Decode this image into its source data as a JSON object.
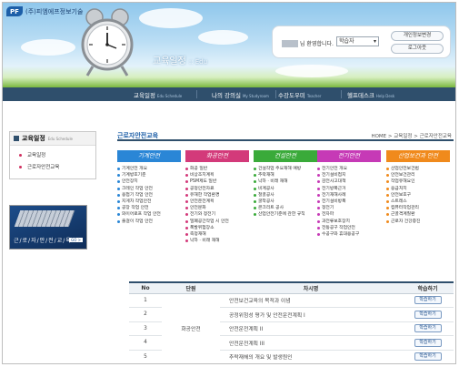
{
  "logo": {
    "badge": "PF",
    "company": "(주)피엠에프정보기술"
  },
  "header": {
    "title": "교육일정",
    "title_sub": ":: Edu"
  },
  "login": {
    "greeting": "님 환영합니다.",
    "role_selected": "학습자",
    "personal_info_btn": "개인정보변경",
    "logout_btn": "로그아웃"
  },
  "nav": {
    "items": [
      {
        "label": "교육일정",
        "sub": "Edu Schedule"
      },
      {
        "label": "나의 강의실",
        "sub": "My Studyroom"
      },
      {
        "label": "수강도우미",
        "sub": "Teacher"
      },
      {
        "label": "헬프데스크",
        "sub": "Help Desk"
      }
    ]
  },
  "sidebar": {
    "title": "교육일정",
    "title_sub": "Edu Schedule",
    "items": [
      {
        "label": "교육일정"
      },
      {
        "label": "근로자안전교육"
      }
    ],
    "banner_text": "근/로/자/안/전/교/육",
    "banner_go": "GO >"
  },
  "main": {
    "page_title": "근로자안전교육",
    "breadcrumb": "HOME > 교육일정 > 근로자안전교육",
    "categories": [
      {
        "title": "기계안전",
        "color": "#2a86d6",
        "items": [
          "기계안전 개요",
          "기계방호기준",
          "안전장치",
          "크레인 작업 안전",
          "용접기 작업 안전",
          "지게차 작업안전",
          "공장 작업 안전",
          "와이어로프 작업 안전",
          "줄걸이 작업 안전"
        ]
      },
      {
        "title": "화공안전",
        "color": "#d33a7a",
        "items": [
          "화공 일반",
          "비상조치계획",
          "PSM제도 일반",
          "공정안전자료",
          "유해한 작업환경",
          "안전운전계획",
          "안전문화",
          "전기와 정전기",
          "밀폐공간작업 시 안전",
          "폭발위험장소",
          "측정재해",
          "낙하 · 비래 재해"
        ]
      },
      {
        "title": "건설안전",
        "color": "#3aaa3a",
        "items": [
          "건설작업 주요재해 예방",
          "추락재해",
          "낙하 · 비래 재해",
          "비계공사",
          "철골공사",
          "굴착공사",
          "콘크리트 공사",
          "산업안전기준에 관한 규칙"
        ]
      },
      {
        "title": "전기안전",
        "color": "#c63ab6",
        "items": [
          "전기안전 개요",
          "전기설비접지",
          "감전사고대책",
          "전기방폭근거",
          "전기재해사례",
          "전기설비방폭",
          "정전기",
          "전자파",
          "과전류보호장치",
          "전동공구 작업안전",
          "수공구와 휴대용공구"
        ]
      },
      {
        "title": "산업보건과 안전",
        "color": "#f08a1c",
        "items": [
          "산업안전보건법",
          "안전보건관리",
          "작업유해요인",
          "응급처치",
          "안전보호구",
          "스트레스",
          "컴퓨터작업관리",
          "근골격계질환",
          "근로자 건강증진"
        ]
      }
    ],
    "table": {
      "headers": [
        "No",
        "단원",
        "차시명",
        "학습하기"
      ],
      "unit": "화공안전",
      "rows": [
        {
          "no": "1",
          "title": "안전보건교육의 목적과 이념",
          "btn": "학습하기"
        },
        {
          "no": "2",
          "title": "공정위험성 평가 및 안전운전계획 I",
          "btn": "학습하기"
        },
        {
          "no": "3",
          "title": "안전운전계획 II",
          "btn": "학습하기"
        },
        {
          "no": "4",
          "title": "안전운전계획 III",
          "btn": "학습하기"
        },
        {
          "no": "5",
          "title": "추락재해의 개요 및 발생원인",
          "btn": "학습하기"
        }
      ]
    }
  }
}
